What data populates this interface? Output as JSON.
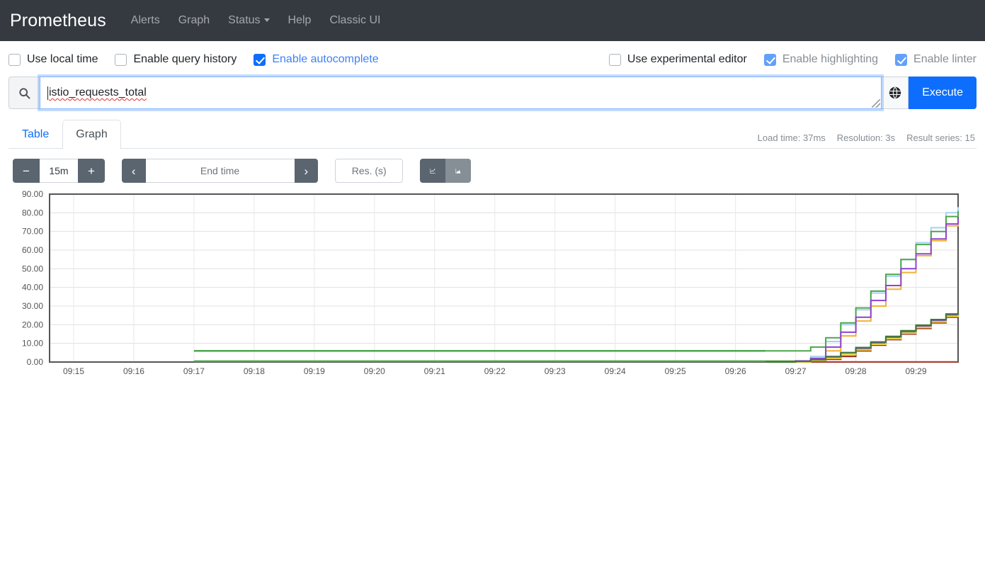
{
  "navbar": {
    "brand": "Prometheus",
    "links": [
      {
        "label": "Alerts",
        "has_caret": false
      },
      {
        "label": "Graph",
        "has_caret": false
      },
      {
        "label": "Status",
        "has_caret": true
      },
      {
        "label": "Help",
        "has_caret": false
      },
      {
        "label": "Classic UI",
        "has_caret": false
      }
    ]
  },
  "options": {
    "left": [
      {
        "label": "Use local time",
        "checked": false,
        "disabled": false
      },
      {
        "label": "Enable query history",
        "checked": false,
        "disabled": false
      },
      {
        "label": "Enable autocomplete",
        "checked": true,
        "disabled": false
      }
    ],
    "right": [
      {
        "label": "Use experimental editor",
        "checked": false,
        "disabled": false
      },
      {
        "label": "Enable highlighting",
        "checked": true,
        "disabled": true
      },
      {
        "label": "Enable linter",
        "checked": true,
        "disabled": true
      }
    ]
  },
  "query": {
    "search_icon": "search-icon",
    "value": "istio_requests_total",
    "globe_icon": "globe-icon",
    "execute_label": "Execute"
  },
  "tabs": [
    {
      "label": "Table",
      "active": false
    },
    {
      "label": "Graph",
      "active": true
    }
  ],
  "meta": {
    "load_time": "Load time: 37ms",
    "resolution": "Resolution: 3s",
    "result_series": "Result series: 15"
  },
  "toolbar": {
    "decrease_label": "−",
    "range_value": "15m",
    "increase_label": "+",
    "prev_label": "‹",
    "end_time_placeholder": "End time",
    "next_label": "›",
    "resolution_placeholder": "Res. (s)",
    "line_chart_icon": "line-chart-icon",
    "stacked_chart_icon": "stacked-area-chart-icon"
  },
  "colors": {
    "accent": "#0d6efd",
    "navbar_bg": "#343a40",
    "dark_btn": "#5a6570"
  },
  "chart_data": {
    "type": "line",
    "title": "",
    "xlabel": "",
    "ylabel": "",
    "ylim": [
      0,
      90
    ],
    "ytick_step": 10,
    "ytick_labels": [
      "0.00",
      "10.00",
      "20.00",
      "30.00",
      "40.00",
      "50.00",
      "60.00",
      "70.00",
      "80.00",
      "90.00"
    ],
    "xtick_labels": [
      "09:15",
      "09:16",
      "09:17",
      "09:18",
      "09:19",
      "09:20",
      "09:21",
      "09:22",
      "09:23",
      "09:24",
      "09:25",
      "09:26",
      "09:27",
      "09:28",
      "09:29"
    ],
    "xlim": [
      "09:14.6",
      "09:29.7"
    ],
    "grid": true,
    "legend": "none",
    "step_style": "step-after",
    "x_minutes": [
      14.6,
      15,
      16,
      17,
      18,
      19,
      20,
      21,
      22,
      23,
      24,
      25,
      26,
      26.5,
      27,
      27.25,
      27.5,
      27.75,
      28,
      28.25,
      28.5,
      28.75,
      29,
      29.25,
      29.5,
      29.7
    ],
    "series": [
      {
        "name": "series-1-lightblue",
        "color": "#a5d3f3",
        "width": 2,
        "values": [
          null,
          null,
          null,
          null,
          null,
          null,
          null,
          null,
          null,
          null,
          null,
          null,
          null,
          0,
          0,
          3,
          11,
          20,
          28,
          37,
          46,
          55,
          64,
          72,
          80,
          83
        ]
      },
      {
        "name": "series-2-green",
        "color": "#4ca64c",
        "width": 2,
        "values": [
          null,
          null,
          null,
          null,
          null,
          null,
          null,
          null,
          null,
          null,
          null,
          null,
          null,
          6,
          6,
          8,
          13,
          21,
          29,
          38,
          47,
          55,
          63,
          70,
          78,
          81
        ]
      },
      {
        "name": "series-3-orange",
        "color": "#f2b134",
        "width": 2,
        "values": [
          null,
          null,
          null,
          null,
          null,
          null,
          null,
          null,
          null,
          null,
          null,
          null,
          null,
          0,
          0,
          1,
          6,
          14,
          22,
          30,
          39,
          48,
          57,
          65,
          73,
          76
        ]
      },
      {
        "name": "series-4-purple",
        "color": "#8e44d0",
        "width": 2,
        "values": [
          null,
          null,
          null,
          null,
          null,
          null,
          null,
          null,
          null,
          null,
          null,
          null,
          null,
          0,
          0,
          2,
          8,
          16,
          24,
          33,
          41,
          50,
          58,
          66,
          74,
          77
        ]
      },
      {
        "name": "series-5-flat-green-6",
        "color": "#4ca64c",
        "width": 2.5,
        "values": [
          null,
          null,
          null,
          6,
          6,
          6,
          6,
          6,
          6,
          6,
          6,
          6,
          6,
          6,
          null,
          null,
          null,
          null,
          null,
          null,
          null,
          null,
          null,
          null,
          null,
          null
        ]
      },
      {
        "name": "series-6-flat-green-0",
        "color": "#4ca64c",
        "width": 2.5,
        "values": [
          null,
          null,
          null,
          0.4,
          0.4,
          0.4,
          0.4,
          0.4,
          0.4,
          0.4,
          0.4,
          0.4,
          0.4,
          0.4,
          0.4,
          1,
          2,
          4,
          7,
          10,
          13,
          16,
          19,
          22,
          25,
          26.5
        ]
      },
      {
        "name": "series-7-orange-stub",
        "color": "#f2b134",
        "width": 2.5,
        "values": [
          null,
          null,
          null,
          0.4,
          null,
          null,
          null,
          null,
          null,
          null,
          null,
          null,
          null,
          null,
          null,
          null,
          null,
          null,
          null,
          null,
          null,
          null,
          null,
          null,
          null,
          null
        ]
      },
      {
        "name": "series-8-darkred-base",
        "color": "#c0392b",
        "width": 2,
        "values": [
          null,
          null,
          null,
          null,
          null,
          null,
          null,
          null,
          null,
          null,
          null,
          null,
          null,
          0.1,
          0.1,
          0.1,
          0.1,
          0.1,
          0.1,
          0.1,
          0.1,
          0.1,
          0.1,
          0.1,
          0.1,
          0.1
        ]
      },
      {
        "name": "series-9-darkred-rise",
        "color": "#9b2c20",
        "width": 2,
        "values": [
          null,
          null,
          null,
          null,
          null,
          null,
          null,
          null,
          null,
          null,
          null,
          null,
          null,
          0,
          0,
          0.5,
          1.5,
          3,
          6,
          9,
          12,
          15,
          18,
          21,
          24,
          25
        ]
      },
      {
        "name": "series-10-yellow-rise",
        "color": "#f2d544",
        "width": 2,
        "values": [
          null,
          null,
          null,
          null,
          null,
          null,
          null,
          null,
          null,
          null,
          null,
          null,
          null,
          0,
          0,
          0.8,
          2,
          4,
          6.5,
          9.5,
          12.5,
          15.5,
          18.5,
          21.5,
          24.5,
          25.5
        ]
      },
      {
        "name": "series-11-purple-rise",
        "color": "#8e44d0",
        "width": 2,
        "values": [
          null,
          null,
          null,
          null,
          null,
          null,
          null,
          null,
          null,
          null,
          null,
          null,
          null,
          0,
          0.6,
          1.5,
          3,
          5,
          7.5,
          10.5,
          13.5,
          16.5,
          19.5,
          22.5,
          25.5,
          26
        ]
      },
      {
        "name": "series-12-darkgreen-rise",
        "color": "#3d7a33",
        "width": 2,
        "values": [
          null,
          null,
          null,
          null,
          null,
          null,
          null,
          null,
          null,
          null,
          null,
          null,
          null,
          0,
          0.3,
          1.2,
          2.8,
          5,
          7.8,
          10.8,
          13.8,
          16.8,
          19.8,
          22.8,
          25.8,
          26.8
        ]
      }
    ]
  }
}
